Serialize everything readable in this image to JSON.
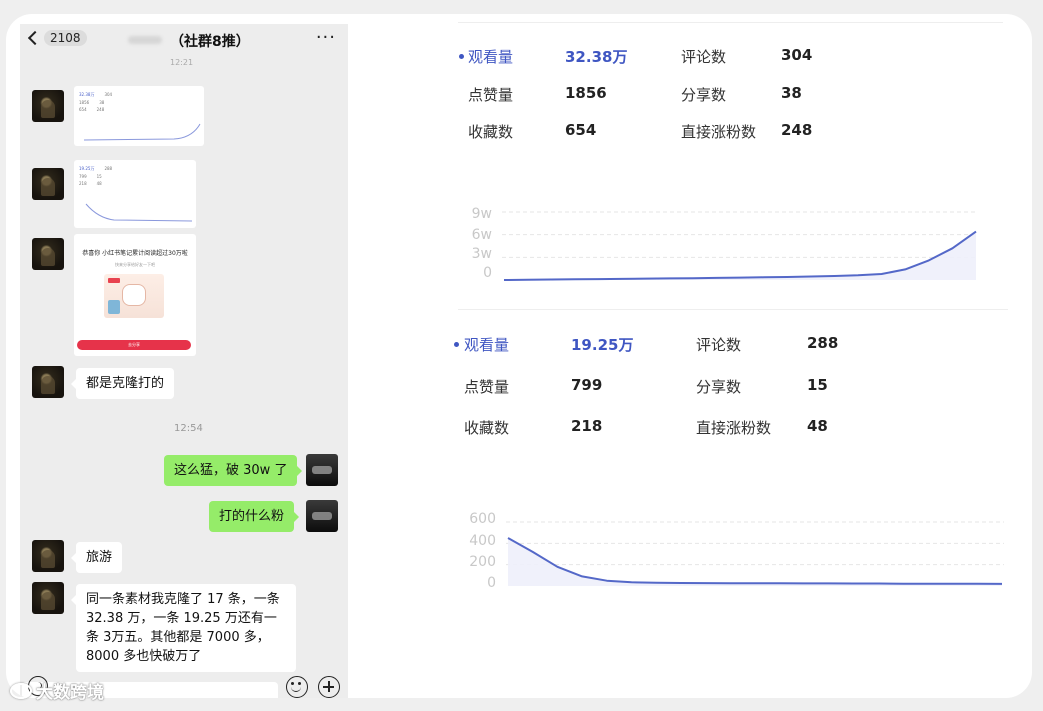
{
  "chat": {
    "back_count": "2108",
    "title": "（社群8推）",
    "more": "···",
    "tiny_time": "12:21",
    "messages": {
      "m1": "都是克隆打的",
      "time2": "12:54",
      "m2": "这么猛，破 30w 了",
      "m3": "打的什么粉",
      "m4": "旅游",
      "m5": "同一条素材我克隆了 17 条，一条 32.38 万，一条 19.25 万还有一条 3万五。其他都是 7000 多，8000 多也快破万了"
    },
    "thumb1": {
      "views": "32.38万",
      "comments": "304",
      "likes": "1856",
      "shares": "38",
      "saves": "654",
      "fans": "248"
    },
    "thumb2": {
      "views": "19.25万",
      "comments": "288",
      "likes": "799",
      "shares": "15",
      "saves": "218",
      "fans": "48"
    },
    "promo": {
      "headline": "恭喜你 小红书笔记累计阅读超过30万啦",
      "sub": "快来分享给好友一下吧",
      "button": "去分享"
    }
  },
  "watermark": "大数跨境",
  "stats_top": {
    "views_label": "观看量",
    "views_value": "32.38万",
    "comments_label": "评论数",
    "comments_value": "304",
    "likes_label": "点赞量",
    "likes_value": "1856",
    "shares_label": "分享数",
    "shares_value": "38",
    "saves_label": "收藏数",
    "saves_value": "654",
    "fans_label": "直接涨粉数",
    "fans_value": "248"
  },
  "stats_bottom": {
    "views_label": "观看量",
    "views_value": "19.25万",
    "comments_label": "评论数",
    "comments_value": "288",
    "likes_label": "点赞量",
    "likes_value": "799",
    "shares_label": "分享数",
    "shares_value": "15",
    "saves_label": "收藏数",
    "saves_value": "218",
    "fans_label": "直接涨粉数",
    "fans_value": "48"
  },
  "colors": {
    "accent": "#3f56c2",
    "bubble_green": "#95ec69",
    "chat_bg": "#ededed"
  },
  "icons": [
    "chevron-left-icon",
    "more-icon",
    "voice-icon",
    "emoji-icon",
    "plus-icon"
  ],
  "chart_data": [
    {
      "type": "area",
      "yticks": [
        "9w",
        "6w",
        "3w",
        "0"
      ],
      "ylim": [
        0,
        90000
      ],
      "x": [
        0,
        1,
        2,
        3,
        4,
        5,
        6,
        7,
        8,
        9,
        10,
        11,
        12,
        13,
        14,
        15,
        16,
        17,
        18,
        19,
        20
      ],
      "values": [
        0,
        300,
        600,
        900,
        1200,
        1500,
        1800,
        2100,
        2400,
        2800,
        3200,
        3600,
        4000,
        4600,
        5300,
        6200,
        8000,
        14000,
        26000,
        42000,
        64000
      ],
      "grid": true
    },
    {
      "type": "area",
      "yticks": [
        "600",
        "400",
        "200",
        "0"
      ],
      "ylim": [
        0,
        600
      ],
      "x": [
        0,
        1,
        2,
        3,
        4,
        5,
        6,
        7,
        8,
        9,
        10,
        11,
        12,
        13,
        14,
        15,
        16,
        17,
        18,
        19,
        20
      ],
      "values": [
        450,
        320,
        180,
        90,
        50,
        35,
        30,
        28,
        27,
        26,
        25,
        25,
        24,
        24,
        23,
        23,
        22,
        22,
        21,
        21,
        20
      ],
      "grid": true
    }
  ]
}
